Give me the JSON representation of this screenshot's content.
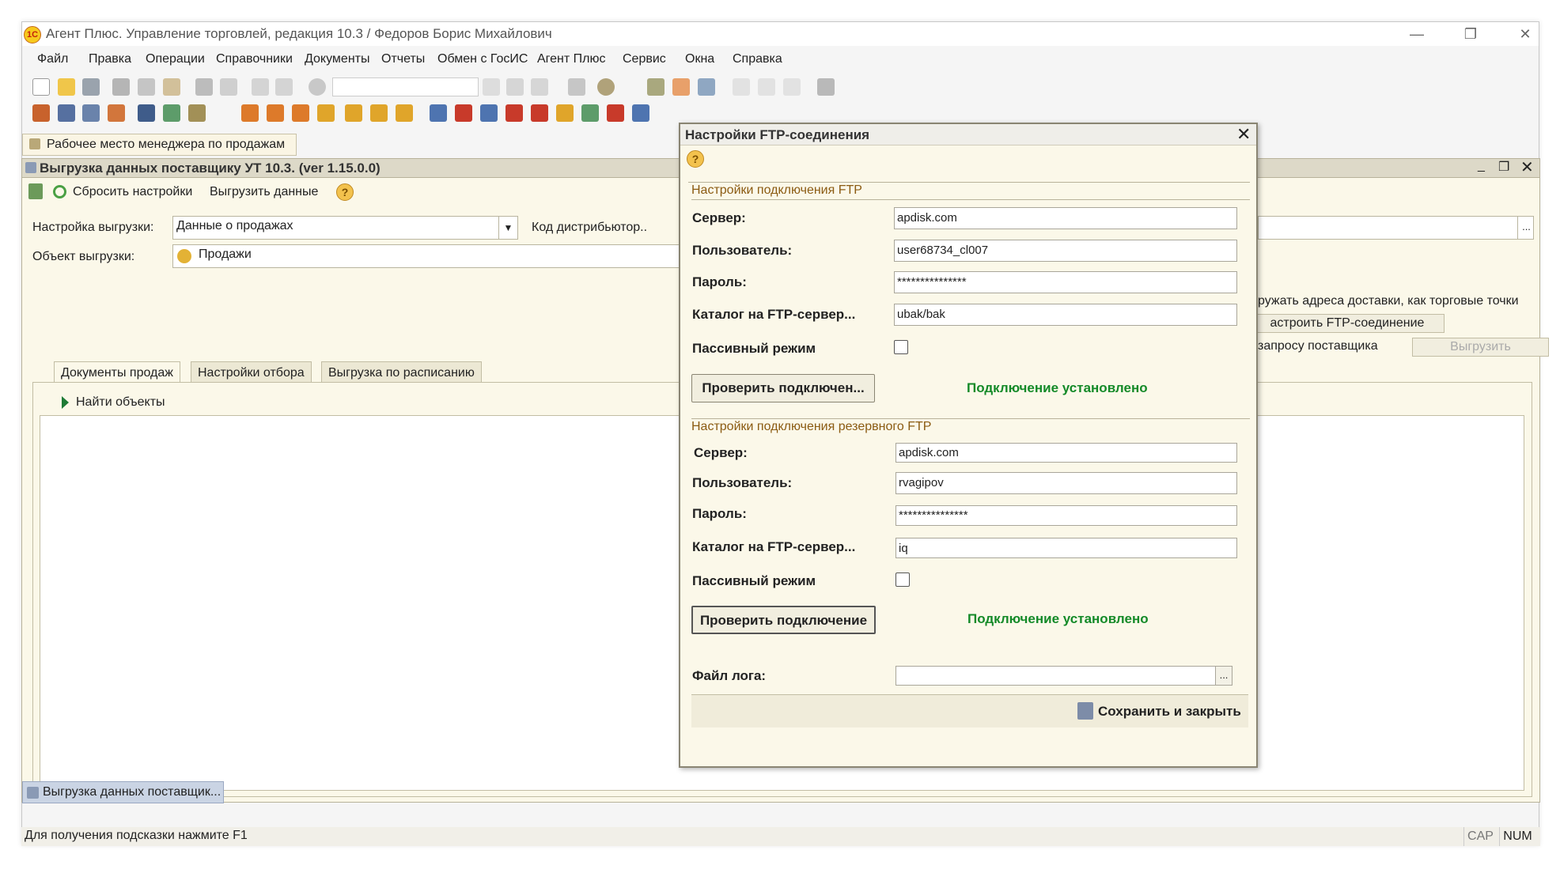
{
  "app": {
    "title": "Агент Плюс. Управление торговлей, редакция 10.3 / Федоров Борис Михайлович"
  },
  "menu": [
    "Файл",
    "Правка",
    "Операции",
    "Справочники",
    "Документы",
    "Отчеты",
    "Обмен с ГосИС",
    "Агент Плюс",
    "Сервис",
    "Окна",
    "Справка"
  ],
  "window_tab": "Рабочее место менеджера по продажам",
  "subwindow": {
    "title": "Выгрузка данных поставщику УТ 10.3. (ver 1.15.0.0)",
    "toolbar": {
      "reset": "Сбросить настройки",
      "export": "Выгрузить данные"
    },
    "setting_label": "Настройка выгрузки:",
    "setting_value": "Данные о продажах",
    "distributor_label": "Код дистрибьютор..",
    "object_label": "Объект выгрузки:",
    "object_value": "Продажи",
    "right_text": "ружать адреса доставки, как торговые точки",
    "ftp_button": "астроить FTP-соединение",
    "request_text": "запросу поставщика",
    "export_button": "Выгрузить",
    "tabs": [
      "Документы продаж",
      "Настройки отбора",
      "Выгрузка по расписанию"
    ],
    "find_objects": "Найти объекты"
  },
  "dialog": {
    "title": "Настройки FTP-соединения",
    "primary": {
      "section": "Настройки подключения FTP",
      "server_label": "Сервер:",
      "server": "apdisk.com",
      "user_label": "Пользователь:",
      "user": "user68734_cl007",
      "pass_label": "Пароль:",
      "pass": "***************",
      "dir_label": "Каталог на FTP-сервер...",
      "dir": "ubak/bak",
      "passive_label": "Пассивный режим",
      "check_button": "Проверить подключен...",
      "status": "Подключение установлено"
    },
    "backup": {
      "section": "Настройки подключения резервного FTP",
      "server_label": "Сервер:",
      "server": "apdisk.com",
      "user_label": "Пользователь:",
      "user": "rvagipov",
      "pass_label": "Пароль:",
      "pass": "***************",
      "dir_label": "Каталог на FTP-сервер...",
      "dir": "iq",
      "passive_label": "Пассивный режим",
      "check_button": "Проверить подключение",
      "status": "Подключение установлено"
    },
    "log_label": "Файл лога:",
    "log_value": "",
    "browse": "...",
    "save_button": "Сохранить и закрыть"
  },
  "taskbar_item": "Выгрузка данных поставщик...",
  "status": {
    "hint": "Для получения подсказки нажмите F1",
    "cap": "CAP",
    "num": "NUM"
  }
}
